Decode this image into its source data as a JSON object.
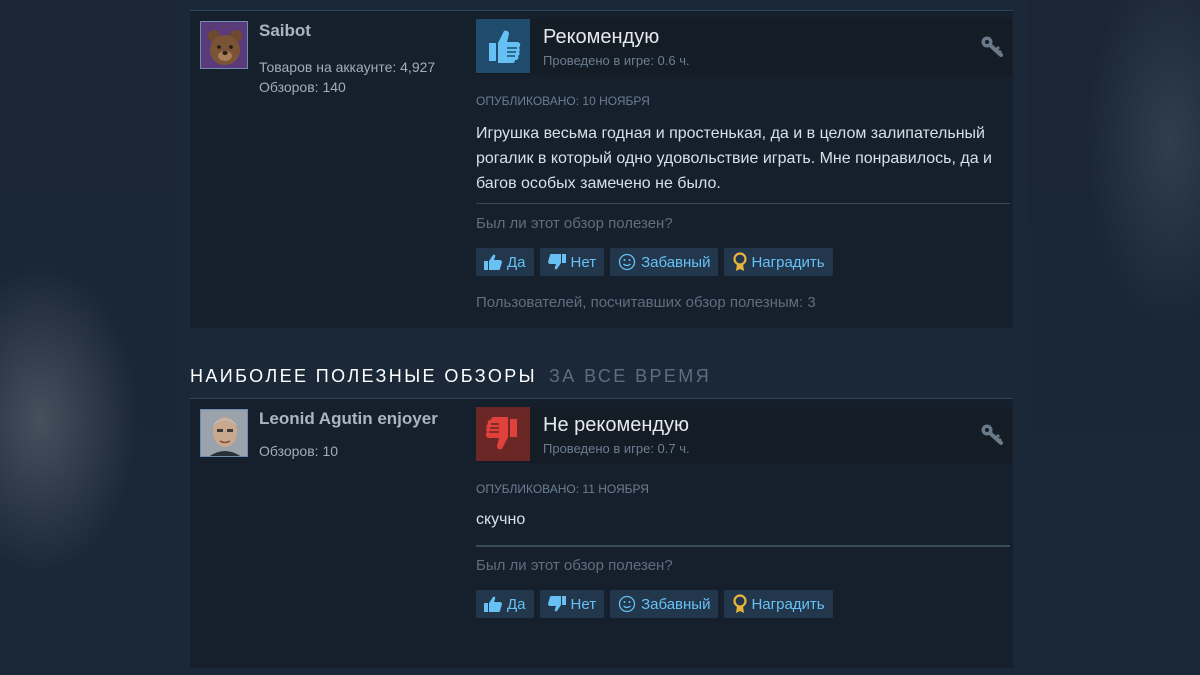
{
  "section": {
    "title": "НАИБОЛЕЕ ПОЛЕЗНЫЕ ОБЗОРЫ",
    "timeframe": "ЗА ВСЕ ВРЕМЯ"
  },
  "reviews": [
    {
      "author": {
        "name": "Saibot",
        "products": "Товаров на аккаунте: 4,927",
        "reviews": "Обзоров: 140",
        "avatar_icon": "bear-avatar"
      },
      "verdict": "Рекомендую",
      "verdict_icon": "thumbs-up-icon",
      "playtime": "Проведено в игре: 0.6 ч.",
      "posted": "ОПУБЛИКОВАНО: 10 НОЯБРЯ",
      "text": "Игрушка весьма годная и простенькая, да и в целом залипательный рогалик в который одно удовольствие играть. Мне понравилось, да и багов особых замечено не было.",
      "helpful_question": "Был ли этот обзор полезен?",
      "buttons": {
        "yes": "Да",
        "no": "Нет",
        "funny": "Забавный",
        "award": "Наградить"
      },
      "found_helpful": "Пользователей, посчитавших обзор полезным: 3"
    },
    {
      "author": {
        "name": "Leonid Agutin enjoyer",
        "reviews": "Обзоров: 10",
        "avatar_icon": "person-avatar"
      },
      "verdict": "Не рекомендую",
      "verdict_icon": "thumbs-down-icon",
      "playtime": "Проведено в игре: 0.7 ч.",
      "posted": "ОПУБЛИКОВАНО: 11 НОЯБРЯ",
      "text": "скучно",
      "helpful_question": "Был ли этот обзор полезен?",
      "buttons": {
        "yes": "Да",
        "no": "Нет",
        "funny": "Забавный",
        "award": "Наградить"
      }
    }
  ],
  "colors": {
    "background": "#1b2838",
    "card": "#16202d",
    "link": "#67c1f5",
    "recommend": "#1f4c6d",
    "not_recommend": "#6b2626"
  }
}
